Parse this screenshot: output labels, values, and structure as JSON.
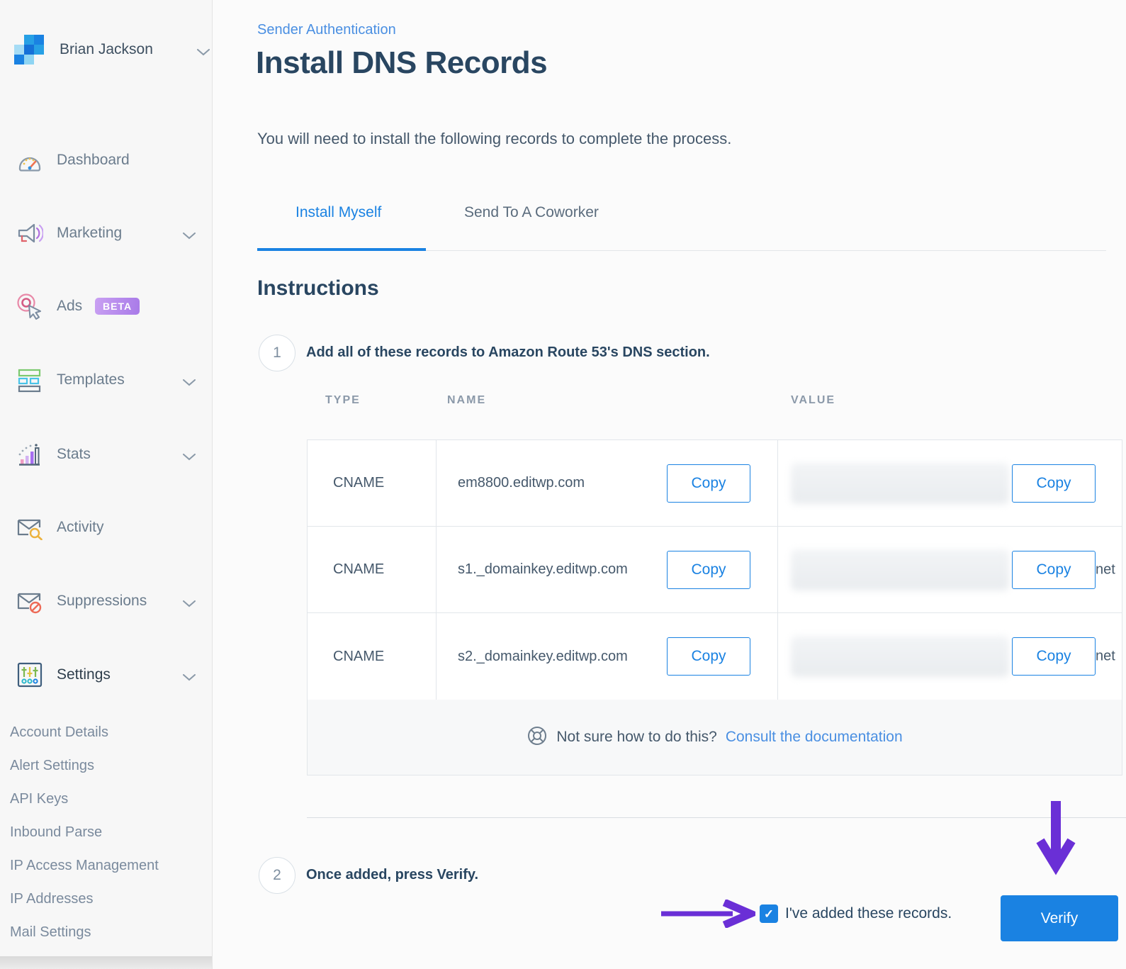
{
  "account": {
    "name": "Brian Jackson"
  },
  "sidebar": {
    "items": [
      {
        "label": "Dashboard",
        "icon": "dashboard-icon",
        "chevron": false
      },
      {
        "label": "Marketing",
        "icon": "marketing-icon",
        "chevron": true
      },
      {
        "label": "Ads",
        "icon": "ads-icon",
        "chevron": false,
        "badge": "BETA"
      },
      {
        "label": "Templates",
        "icon": "templates-icon",
        "chevron": true
      },
      {
        "label": "Stats",
        "icon": "stats-icon",
        "chevron": true
      },
      {
        "label": "Activity",
        "icon": "activity-icon",
        "chevron": false
      },
      {
        "label": "Suppressions",
        "icon": "suppressions-icon",
        "chevron": true
      },
      {
        "label": "Settings",
        "icon": "settings-icon",
        "chevron": true
      }
    ],
    "settings_submenu": [
      "Account Details",
      "Alert Settings",
      "API Keys",
      "Inbound Parse",
      "IP Access Management",
      "IP Addresses",
      "Mail Settings"
    ]
  },
  "page": {
    "breadcrumb": "Sender Authentication",
    "title": "Install DNS Records",
    "intro": "You will need to install the following records to complete the process.",
    "tabs": [
      {
        "label": "Install Myself",
        "active": true
      },
      {
        "label": "Send To A Coworker",
        "active": false
      }
    ],
    "instructions_heading": "Instructions",
    "steps": [
      {
        "number": "1",
        "text": "Add all of these records to Amazon Route 53's DNS section."
      },
      {
        "number": "2",
        "text": "Once added, press Verify."
      }
    ]
  },
  "table": {
    "headers": [
      "TYPE",
      "NAME",
      "VALUE"
    ],
    "copy_label": "Copy",
    "rows": [
      {
        "type": "CNAME",
        "name": "em8800.editwp.com",
        "value_redacted": true,
        "value_suffix": ""
      },
      {
        "type": "CNAME",
        "name": "s1._domainkey.editwp.com",
        "value_redacted": true,
        "value_suffix": "net"
      },
      {
        "type": "CNAME",
        "name": "s2._domainkey.editwp.com",
        "value_redacted": true,
        "value_suffix": "net"
      }
    ],
    "help": {
      "text": "Not sure how to do this?",
      "link": "Consult the documentation"
    }
  },
  "footer_actions": {
    "checkbox_label": "I've added these records.",
    "checkbox_checked": true,
    "verify_label": "Verify"
  },
  "colors": {
    "accent_blue": "#1a82e2",
    "link_blue": "#4a8fe2",
    "heading": "#294661",
    "purple_annotation": "#6a2fd6",
    "sidebar_bg": "#f7f7f7",
    "table_footer_bg": "#f7f8f9"
  }
}
